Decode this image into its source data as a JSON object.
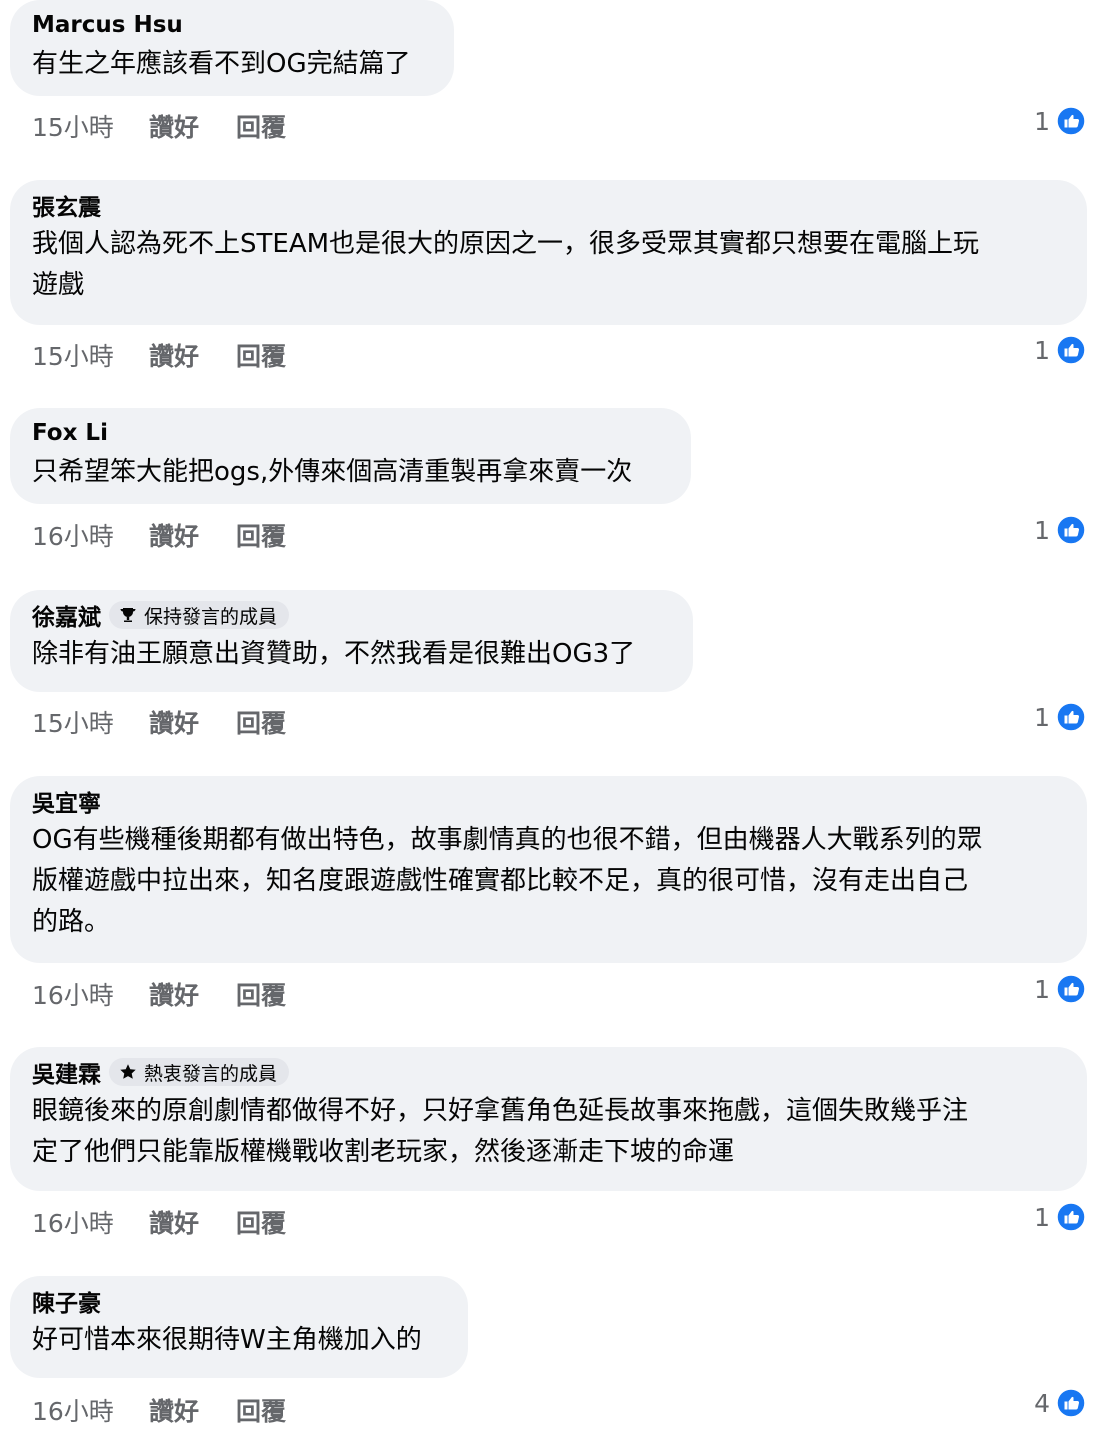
{
  "colors": {
    "bubble_bg": "#f0f2f5",
    "text": "#050505",
    "meta_text": "#65676b",
    "like_blue": "#1877f2"
  },
  "comments": [
    {
      "author": "Marcus Hsu",
      "text": "有生之年應該看不到OG完結篇了",
      "time": "15小時",
      "like_label": "讚好",
      "reply_label": "回覆",
      "reactions": "1"
    },
    {
      "author": "張玄震",
      "text": "我個人認為死不上STEAM也是很大的原因之一，很多受眾其實都只想要在電腦上玩\n遊戲",
      "time": "15小時",
      "like_label": "讚好",
      "reply_label": "回覆",
      "reactions": "1"
    },
    {
      "author": "Fox Li",
      "text": "只希望笨大能把ogs,外傳來個高清重製再拿來賣一次",
      "time": "16小時",
      "like_label": "讚好",
      "reply_label": "回覆",
      "reactions": "1"
    },
    {
      "author": "徐嘉斌",
      "badge": "保持發言的成員",
      "badge_icon": "trophy-icon",
      "text": "除非有油王願意出資贊助，不然我看是很難出OG3了",
      "time": "15小時",
      "like_label": "讚好",
      "reply_label": "回覆",
      "reactions": "1"
    },
    {
      "author": "吳宜寧",
      "text": "OG有些機種後期都有做出特色，故事劇情真的也很不錯，但由機器人大戰系列的眾\n版權遊戲中拉出來，知名度跟遊戲性確實都比較不足，真的很可惜，沒有走出自己\n的路。",
      "time": "16小時",
      "like_label": "讚好",
      "reply_label": "回覆",
      "reactions": "1"
    },
    {
      "author": "吳建霖",
      "badge": "熱衷發言的成員",
      "badge_icon": "star-icon",
      "text": "眼鏡後來的原創劇情都做得不好，只好拿舊角色延長故事來拖戲，這個失敗幾乎注\n定了他們只能靠版權機戰收割老玩家，然後逐漸走下坡的命運",
      "time": "16小時",
      "like_label": "讚好",
      "reply_label": "回覆",
      "reactions": "1"
    },
    {
      "author": "陳子豪",
      "text": "好可惜本來很期待W主角機加入的",
      "time": "16小時",
      "like_label": "讚好",
      "reply_label": "回覆",
      "reactions": "4"
    }
  ]
}
